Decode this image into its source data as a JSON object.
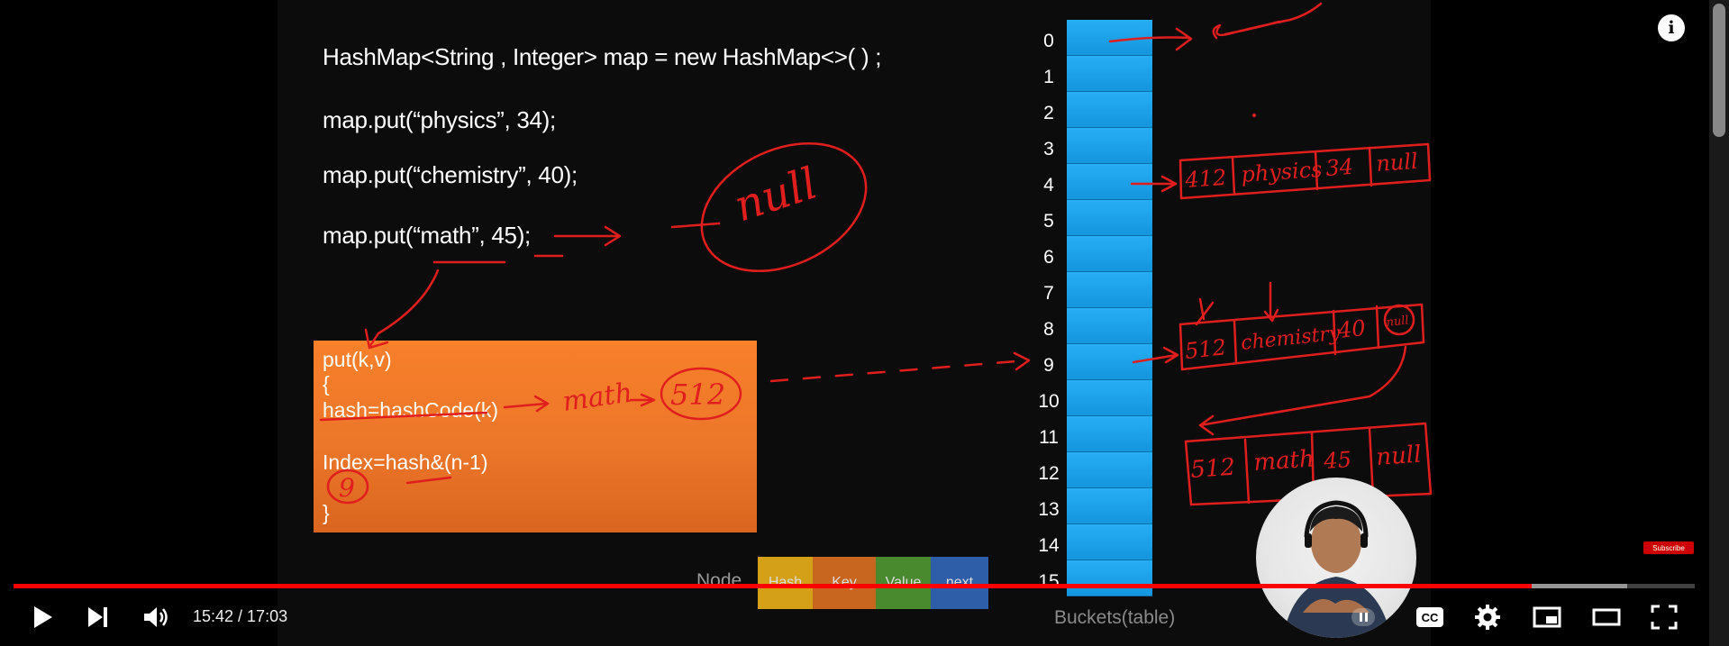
{
  "video": {
    "slide": {
      "code_lines": [
        "HashMap<String , Integer> map = new HashMap<>( ) ;",
        "map.put(“physics”, 34);",
        "map.put(“chemistry”, 40);",
        "map.put(“math”, 45);"
      ],
      "put_box_lines": [
        "put(k,v)",
        "{",
        "hash=hashCode(k)",
        "",
        "Index=hash&(n-1)",
        "",
        "}"
      ],
      "bucket_indices": [
        "0",
        "1",
        "2",
        "3",
        "4",
        "5",
        "6",
        "7",
        "8",
        "9",
        "10",
        "11",
        "12",
        "13",
        "14",
        "15"
      ],
      "buckets_caption": "Buckets(table)",
      "node_caption": "Node",
      "node_fields": [
        {
          "label": "Hash",
          "color": "#d4a017"
        },
        {
          "label": "Key",
          "color": "#c8651e"
        },
        {
          "label": "Value",
          "color": "#4a8a2e"
        },
        {
          "label": "next",
          "color": "#2f5ea8"
        }
      ]
    },
    "handwriting": {
      "null_circle": "null",
      "math_arrow": "math",
      "hash_result": "512",
      "index_result": "9",
      "node_physics": [
        "412",
        "physics",
        "34",
        "null"
      ],
      "node_chemistry": [
        "512",
        "chemistry",
        "40",
        "null"
      ],
      "node_math": [
        "512",
        "math",
        "45",
        "null"
      ]
    },
    "controls": {
      "time": "15:42 / 17:03",
      "progress_played": 0.903,
      "progress_buffered": 0.96,
      "subscribe_label": "Subscribe"
    },
    "icons": [
      "play-icon",
      "next-icon",
      "volume-icon",
      "captions-icon",
      "settings-icon",
      "miniplayer-icon",
      "theater-icon",
      "fullscreen-icon",
      "info-icon"
    ],
    "colors": {
      "accent_red": "#ff0000",
      "bucket_blue": "#1ea3ec",
      "orange_box": "#f27a2a",
      "ink_red": "#e01e1e"
    }
  }
}
